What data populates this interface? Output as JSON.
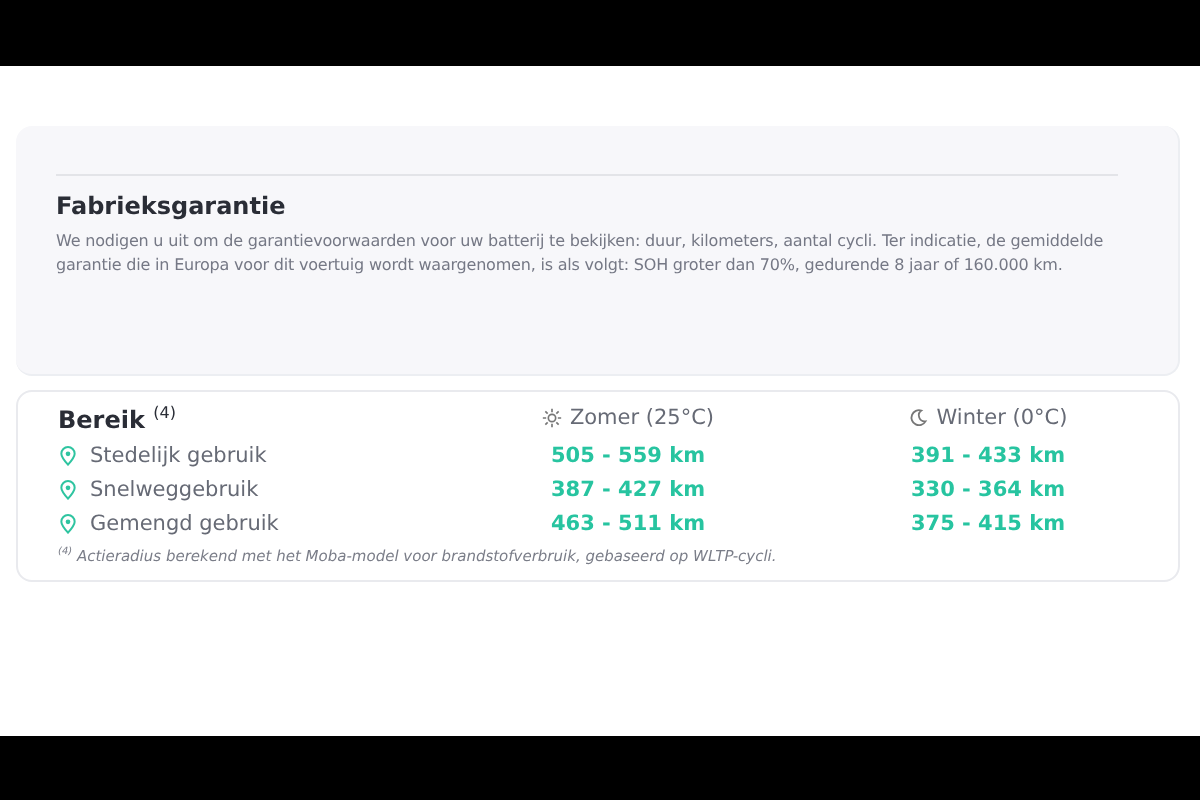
{
  "warranty": {
    "title": "Fabrieksgarantie",
    "text": "We nodigen u uit om de garantievoorwaarden voor uw batterij te bekijken: duur, kilometers, aantal cycli. Ter indicatie, de gemiddelde garantie die in Europa voor dit voertuig wordt waargenomen, is als volgt: SOH groter dan 70%, gedurende 8 jaar of 160.000 km."
  },
  "range": {
    "title": "Bereik $^{(4)}$",
    "columns": [
      {
        "kind": "summer",
        "label": "Zomer (25°C)"
      },
      {
        "kind": "winter",
        "label": "Winter (0°C)"
      }
    ],
    "rows": [
      {
        "label": "Stedelijk gebruik",
        "values": [
          "505 - 559 km",
          "391 - 433 km"
        ]
      },
      {
        "label": "Snelweggebruik",
        "values": [
          "387 - 427 km",
          "330 - 364 km"
        ]
      },
      {
        "label": "Gemengd gebruik",
        "values": [
          "463 - 511 km",
          "375 - 415 km"
        ]
      }
    ],
    "footnote": "$^{(4)}$ Actieradius berekend met het Moba-model voor brandstofverbruik, gebaseerd op WLTP-cycli."
  }
}
